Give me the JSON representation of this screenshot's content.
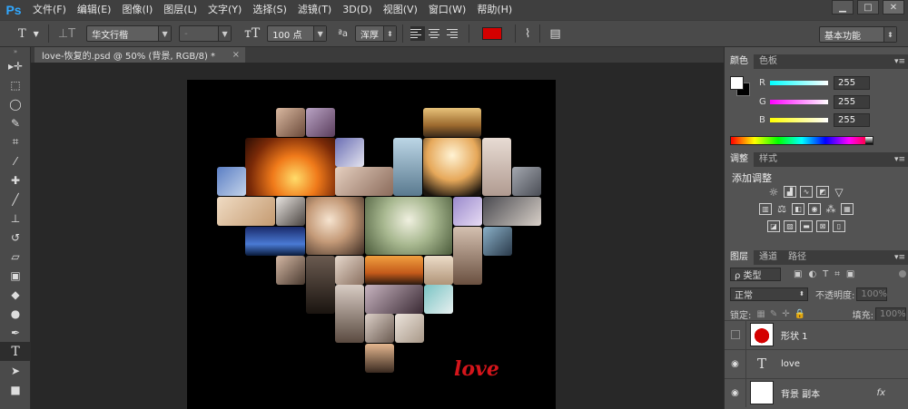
{
  "app": {
    "logo": "Ps"
  },
  "menu": [
    "文件(F)",
    "编辑(E)",
    "图像(I)",
    "图层(L)",
    "文字(Y)",
    "选择(S)",
    "滤镜(T)",
    "3D(D)",
    "视图(V)",
    "窗口(W)",
    "帮助(H)"
  ],
  "window_controls": {
    "minimize": "▁",
    "maximize": "□",
    "close": "✕"
  },
  "options": {
    "tool_icon": "T",
    "font_family": "华文行楷",
    "font_style": "-",
    "font_size": "100 点",
    "aa_label": "ªa",
    "aa_mode": "浑厚",
    "text_color": "#d40000",
    "workspace": "基本功能"
  },
  "document": {
    "tab_title": "love-恢复的.psd @ 50% (背景, RGB/8) *",
    "close": "×",
    "overlay_text": "love"
  },
  "color_panel": {
    "tabs": [
      "颜色",
      "色板"
    ],
    "r_label": "R",
    "r_value": "255",
    "g_label": "G",
    "g_value": "255",
    "b_label": "B",
    "b_value": "255"
  },
  "adjust_panel": {
    "tabs": [
      "调整",
      "样式"
    ],
    "title": "添加调整"
  },
  "layers_panel": {
    "tabs": [
      "图层",
      "通道",
      "路径"
    ],
    "filter": "ρ 类型",
    "blend_mode": "正常",
    "opacity_label": "不透明度:",
    "opacity_value": "100%",
    "lock_label": "锁定:",
    "fill_label": "填充:",
    "fill_value": "100%",
    "layers": [
      {
        "name": "形状 1"
      },
      {
        "name": "love"
      },
      {
        "name": "背景 副本",
        "fx": "fx"
      }
    ]
  }
}
